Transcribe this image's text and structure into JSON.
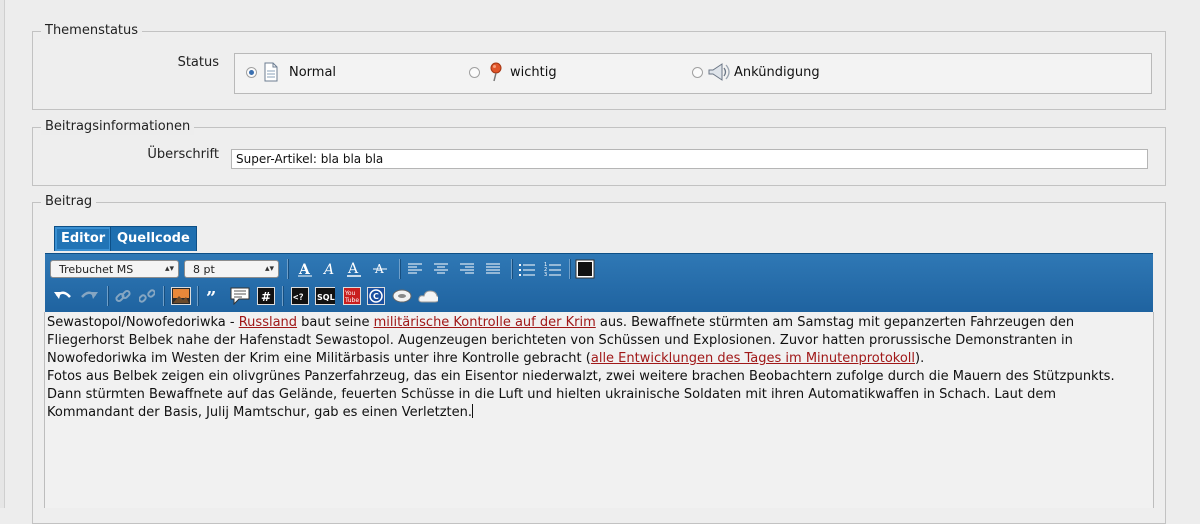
{
  "sections": {
    "themenstatus": "Themenstatus",
    "beitragsinformationen": "Beitragsinformationen",
    "beitrag": "Beitrag"
  },
  "status": {
    "label": "Status",
    "options": [
      {
        "label": "Normal",
        "icon": "document-icon",
        "checked": true
      },
      {
        "label": "wichtig",
        "icon": "pushpin-icon",
        "checked": false
      },
      {
        "label": "Ankündigung",
        "icon": "megaphone-icon",
        "checked": false
      }
    ]
  },
  "post_info": {
    "label": "Überschrift",
    "title_value": "Super-Artikel: bla bla bla"
  },
  "editor": {
    "tabs": [
      "Editor",
      "Quellcode"
    ],
    "active_tab": "Editor",
    "font_family": "Trebuchet MS",
    "font_size": "8 pt",
    "toolbar_row1": [
      "font-bold-icon",
      "font-italic-icon",
      "font-underline-icon",
      "font-strike-icon",
      "align-left-icon",
      "align-center-icon",
      "align-right-icon",
      "align-justify-icon",
      "bullet-list-icon",
      "numbered-list-icon",
      "text-color-icon"
    ],
    "toolbar_row2": [
      "undo-icon",
      "redo-icon",
      "link-icon",
      "unlink-icon",
      "image-icon",
      "quote-icon",
      "comment-icon",
      "hash-icon",
      "code-icon",
      "sql-icon",
      "youtube-icon",
      "copyright-icon",
      "spoiler-icon",
      "soundcloud-icon"
    ],
    "content": {
      "p1": {
        "t1": "Sewastopol/Nowofedoriwka - ",
        "l1": "Russland",
        "t2": " baut seine ",
        "l2": "militärische Kontrolle auf der Krim",
        "t3": " aus. Bewaffnete stürmten am Samstag mit gepanzerten Fahrzeugen den",
        "line2": "Fliegerhorst Belbek nahe der Hafenstadt Sewastopol. Augenzeugen berichteten von Schüssen und Explosionen. Zuvor hatten prorussische Demonstranten in",
        "t4": "Nowofedoriwka im Westen der Krim eine Militärbasis unter ihre Kontrolle gebracht (",
        "l3": "alle Entwicklungen des Tages im Minutenprotokoll",
        "t5": ")."
      },
      "p2": {
        "line1": "Fotos aus Belbek zeigen ein olivgrünes Panzerfahrzeug, das ein Eisentor niederwalzt, zwei weitere brachen Beobachtern zufolge durch die Mauern des Stützpunkts.",
        "line2": "Dann stürmten Bewaffnete auf das Gelände, feuerten Schüsse in die Luft und hielten ukrainische Soldaten mit ihren Automatikwaffen in Schach. Laut dem",
        "line3": "Kommandant der Basis, Julij Mamtschur, gab es einen Verletzten."
      }
    }
  },
  "colors": {
    "toolbar": "#2a6eaa",
    "tab": "#2174b6",
    "link": "#a01818"
  }
}
